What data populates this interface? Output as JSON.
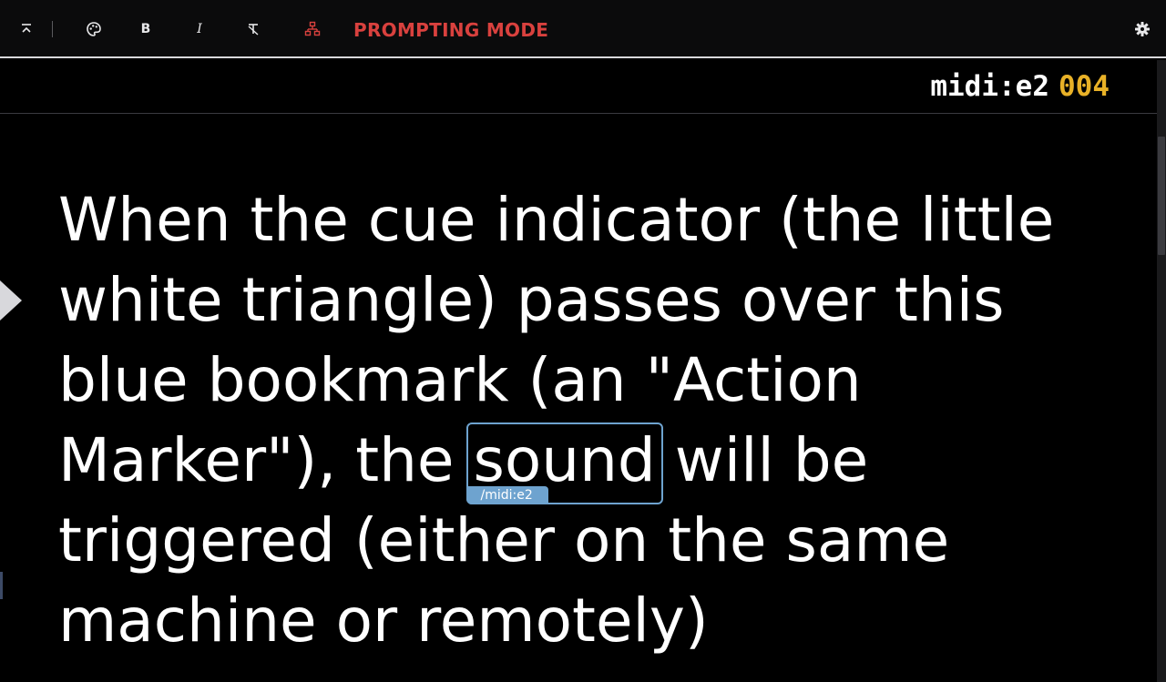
{
  "toolbar": {
    "mode_label": "PROMPTING MODE",
    "bold_label": "B",
    "italic_label": "I",
    "icons": [
      "collapse-top-icon",
      "palette-icon",
      "bold-icon",
      "italic-icon",
      "clear-format-icon",
      "sitemap-icon",
      "gear-icon"
    ]
  },
  "cue": {
    "name": "midi:e2",
    "number": "004"
  },
  "script": {
    "line1": "When the cue indicator (the little",
    "line2": "white triangle) passes over this",
    "line3": "blue bookmark (an \"Action",
    "line4_before": "Marker\"), the ",
    "line4_marked": "sound",
    "line4_after": " will be",
    "line5": "triggered (either on the same",
    "line6": "machine or remotely)"
  },
  "action_marker": {
    "tag": "/midi:e2"
  },
  "colors": {
    "mode_label": "#d9413e",
    "cue_number": "#e8b127",
    "marker": "#6ea3cf"
  }
}
